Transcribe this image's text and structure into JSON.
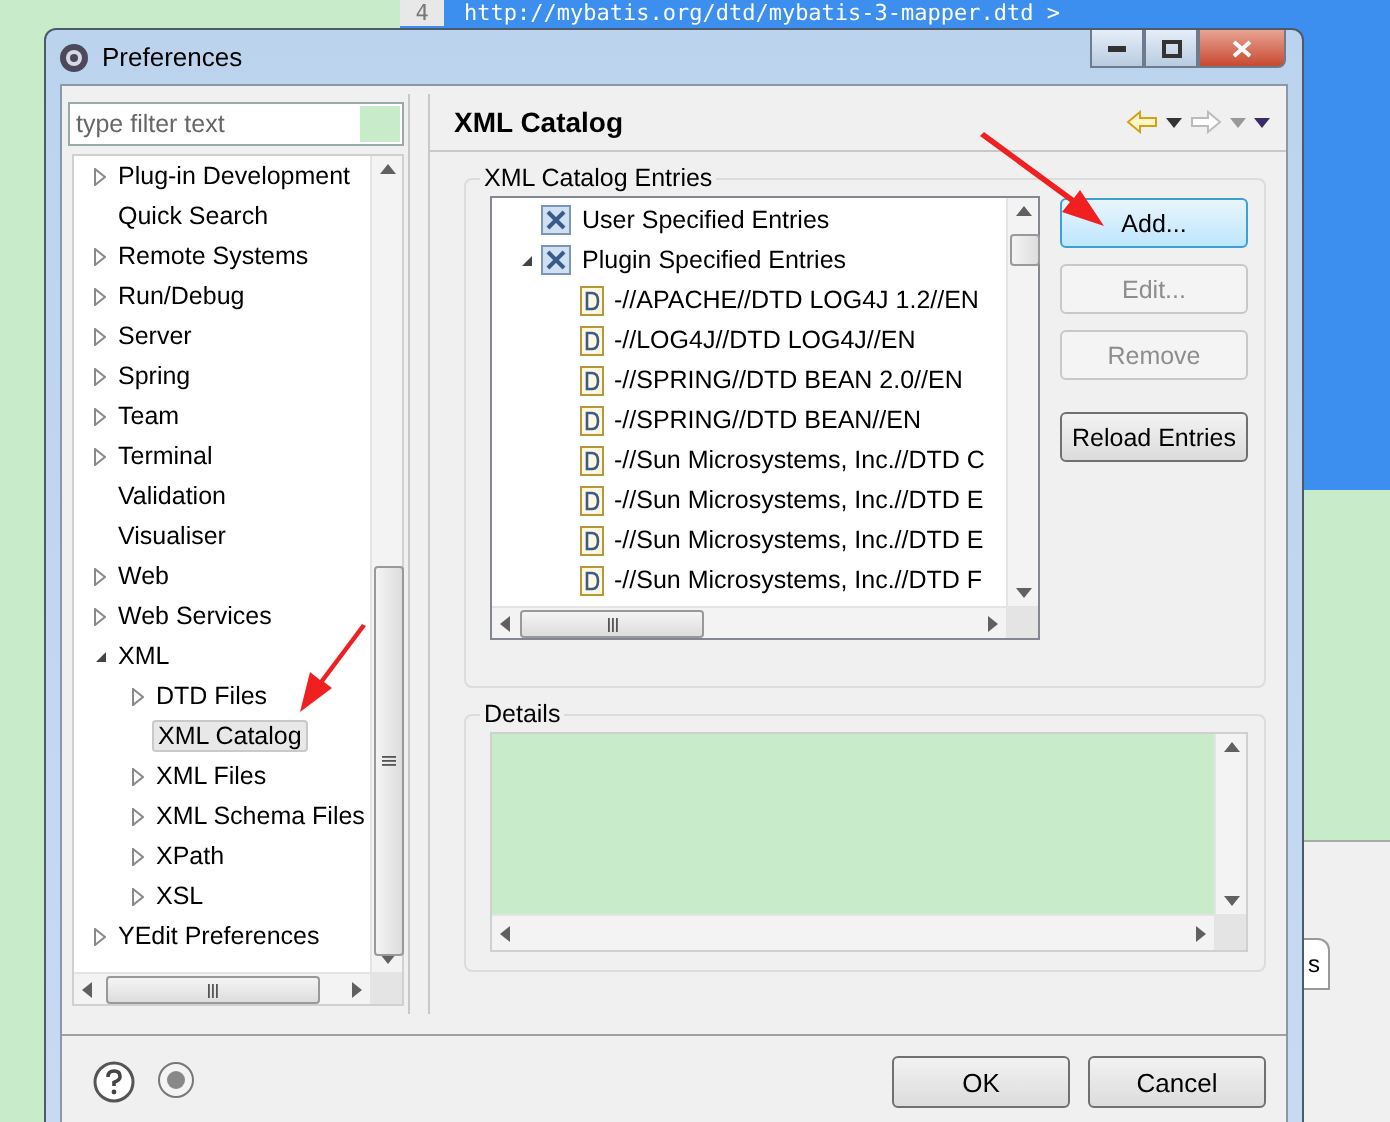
{
  "background": {
    "line_number": "4",
    "code_text": "http://mybatis.org/dtd/mybatis-3-mapper.dtd >",
    "tab_text": "s"
  },
  "window": {
    "title": "Preferences"
  },
  "filter": {
    "placeholder": "type filter text"
  },
  "tree": [
    {
      "label": "Plug-in Development",
      "kind": "group",
      "expanded": false,
      "selected": false
    },
    {
      "label": "Quick Search",
      "kind": "leaf",
      "selected": false
    },
    {
      "label": "Remote Systems",
      "kind": "group",
      "expanded": false,
      "selected": false
    },
    {
      "label": "Run/Debug",
      "kind": "group",
      "expanded": false,
      "selected": false
    },
    {
      "label": "Server",
      "kind": "group",
      "expanded": false,
      "selected": false
    },
    {
      "label": "Spring",
      "kind": "group",
      "expanded": false,
      "selected": false
    },
    {
      "label": "Team",
      "kind": "group",
      "expanded": false,
      "selected": false
    },
    {
      "label": "Terminal",
      "kind": "group",
      "expanded": false,
      "selected": false
    },
    {
      "label": "Validation",
      "kind": "leaf",
      "selected": false
    },
    {
      "label": "Visualiser",
      "kind": "leaf",
      "selected": false
    },
    {
      "label": "Web",
      "kind": "group",
      "expanded": false,
      "selected": false
    },
    {
      "label": "Web Services",
      "kind": "group",
      "expanded": false,
      "selected": false
    },
    {
      "label": "XML",
      "kind": "group",
      "expanded": true,
      "selected": false,
      "children": [
        {
          "label": "DTD Files",
          "kind": "group",
          "expanded": false,
          "selected": false
        },
        {
          "label": "XML Catalog",
          "kind": "leaf",
          "selected": true
        },
        {
          "label": "XML Files",
          "kind": "group",
          "expanded": false,
          "selected": false
        },
        {
          "label": "XML Schema Files",
          "kind": "group",
          "expanded": false,
          "selected": false
        },
        {
          "label": "XPath",
          "kind": "group",
          "expanded": false,
          "selected": false
        },
        {
          "label": "XSL",
          "kind": "group",
          "expanded": false,
          "selected": false
        }
      ]
    },
    {
      "label": "YEdit Preferences",
      "kind": "group",
      "expanded": false,
      "selected": false
    }
  ],
  "page": {
    "title": "XML Catalog",
    "entries_group": "XML Catalog Entries",
    "entries": [
      {
        "label": "User Specified Entries",
        "kind": "catalog"
      },
      {
        "label": "Plugin Specified Entries",
        "kind": "catalog",
        "expanded": true,
        "children": [
          {
            "label": "-//APACHE//DTD LOG4J 1.2//EN",
            "kind": "dtd"
          },
          {
            "label": "-//LOG4J//DTD LOG4J//EN",
            "kind": "dtd"
          },
          {
            "label": "-//SPRING//DTD BEAN 2.0//EN",
            "kind": "dtd"
          },
          {
            "label": "-//SPRING//DTD BEAN//EN",
            "kind": "dtd"
          },
          {
            "label": "-//Sun Microsystems, Inc.//DTD C",
            "kind": "dtd"
          },
          {
            "label": "-//Sun Microsystems, Inc.//DTD E",
            "kind": "dtd"
          },
          {
            "label": "-//Sun Microsystems, Inc.//DTD E",
            "kind": "dtd"
          },
          {
            "label": "-//Sun Microsystems, Inc.//DTD F",
            "kind": "dtd"
          }
        ]
      }
    ],
    "buttons": [
      {
        "label": "Add...",
        "disabled": false,
        "focused": true
      },
      {
        "label": "Edit...",
        "disabled": true,
        "focused": false
      },
      {
        "label": "Remove",
        "disabled": true,
        "focused": false
      },
      {
        "label": "Reload Entries",
        "disabled": false,
        "focused": false
      }
    ],
    "details_group": "Details"
  },
  "dialog_buttons": [
    "OK",
    "Cancel"
  ]
}
